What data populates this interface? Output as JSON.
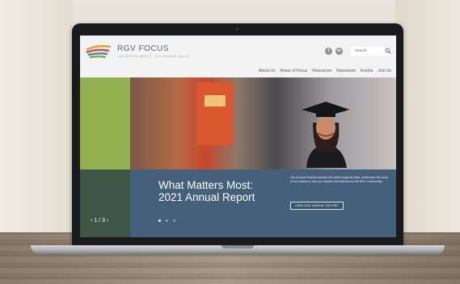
{
  "site": {
    "logo_text": "RGV FOCUS",
    "logo_tagline": "COLLECTIVE IMPACT · RIO GRANDE VALLEY",
    "social": [
      "f",
      "in"
    ],
    "search_placeholder": "Search",
    "nav": [
      "About Us",
      "Areas of Focus",
      "Resources",
      "Newsroom",
      "Events",
      "Join Us"
    ]
  },
  "hero": {
    "title": "What Matters Most: 2021 Annual Report",
    "description": "Our Annual Report includes the latest regional data, celebrates the work of our partners, and our shared commitment to the RGV community.",
    "button_label": "VIEW 2021 ANNUAL REPORT",
    "slide_counter": "‹ 1 / 3 ›",
    "slides": 3,
    "active_slide": 1
  },
  "colors": {
    "accent_green": "#93b151",
    "panel_blue": "#45607a",
    "nav_text": "#4d5a64"
  }
}
